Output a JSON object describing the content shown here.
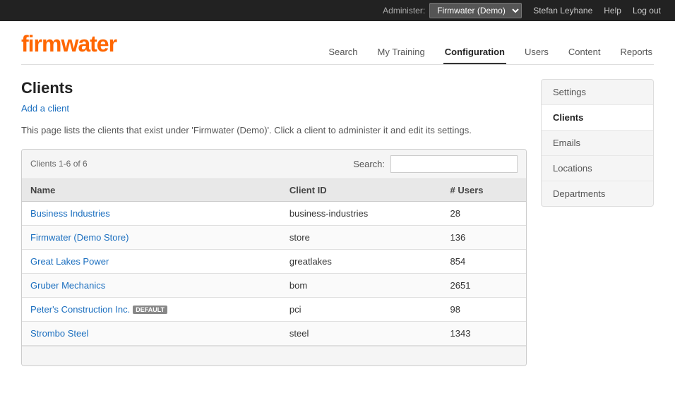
{
  "topbar": {
    "administer_label": "Administer:",
    "selected_account": "Firmwater (Demo)",
    "user_name": "Stefan Leyhane",
    "help_label": "Help",
    "logout_label": "Log out"
  },
  "nav": {
    "items": [
      {
        "label": "Search",
        "active": false
      },
      {
        "label": "My Training",
        "active": false
      },
      {
        "label": "Configuration",
        "active": true
      },
      {
        "label": "Users",
        "active": false
      },
      {
        "label": "Content",
        "active": false
      },
      {
        "label": "Reports",
        "active": false
      }
    ]
  },
  "page": {
    "title": "Clients",
    "add_link": "Add a client",
    "description": "This page lists the clients that exist under 'Firmwater (Demo)'. Click a client to administer it and edit its settings.",
    "count_label": "Clients 1-6 of 6",
    "search_label": "Search:",
    "search_placeholder": ""
  },
  "table": {
    "columns": [
      {
        "label": "Name"
      },
      {
        "label": "Client ID"
      },
      {
        "label": "# Users"
      }
    ],
    "rows": [
      {
        "name": "Business Industries",
        "client_id": "business-industries",
        "users": "28",
        "badge": null
      },
      {
        "name": "Firmwater (Demo Store)",
        "client_id": "store",
        "users": "136",
        "badge": null
      },
      {
        "name": "Great Lakes Power",
        "client_id": "greatlakes",
        "users": "854",
        "badge": null
      },
      {
        "name": "Gruber Mechanics",
        "client_id": "bom",
        "users": "2651",
        "badge": null
      },
      {
        "name": "Peter's Construction Inc.",
        "client_id": "pci",
        "users": "98",
        "badge": "default"
      },
      {
        "name": "Strombo Steel",
        "client_id": "steel",
        "users": "1343",
        "badge": null
      }
    ]
  },
  "sidebar": {
    "items": [
      {
        "label": "Settings",
        "active": false
      },
      {
        "label": "Clients",
        "active": true
      },
      {
        "label": "Emails",
        "active": false
      },
      {
        "label": "Locations",
        "active": false
      },
      {
        "label": "Departments",
        "active": false
      }
    ]
  }
}
